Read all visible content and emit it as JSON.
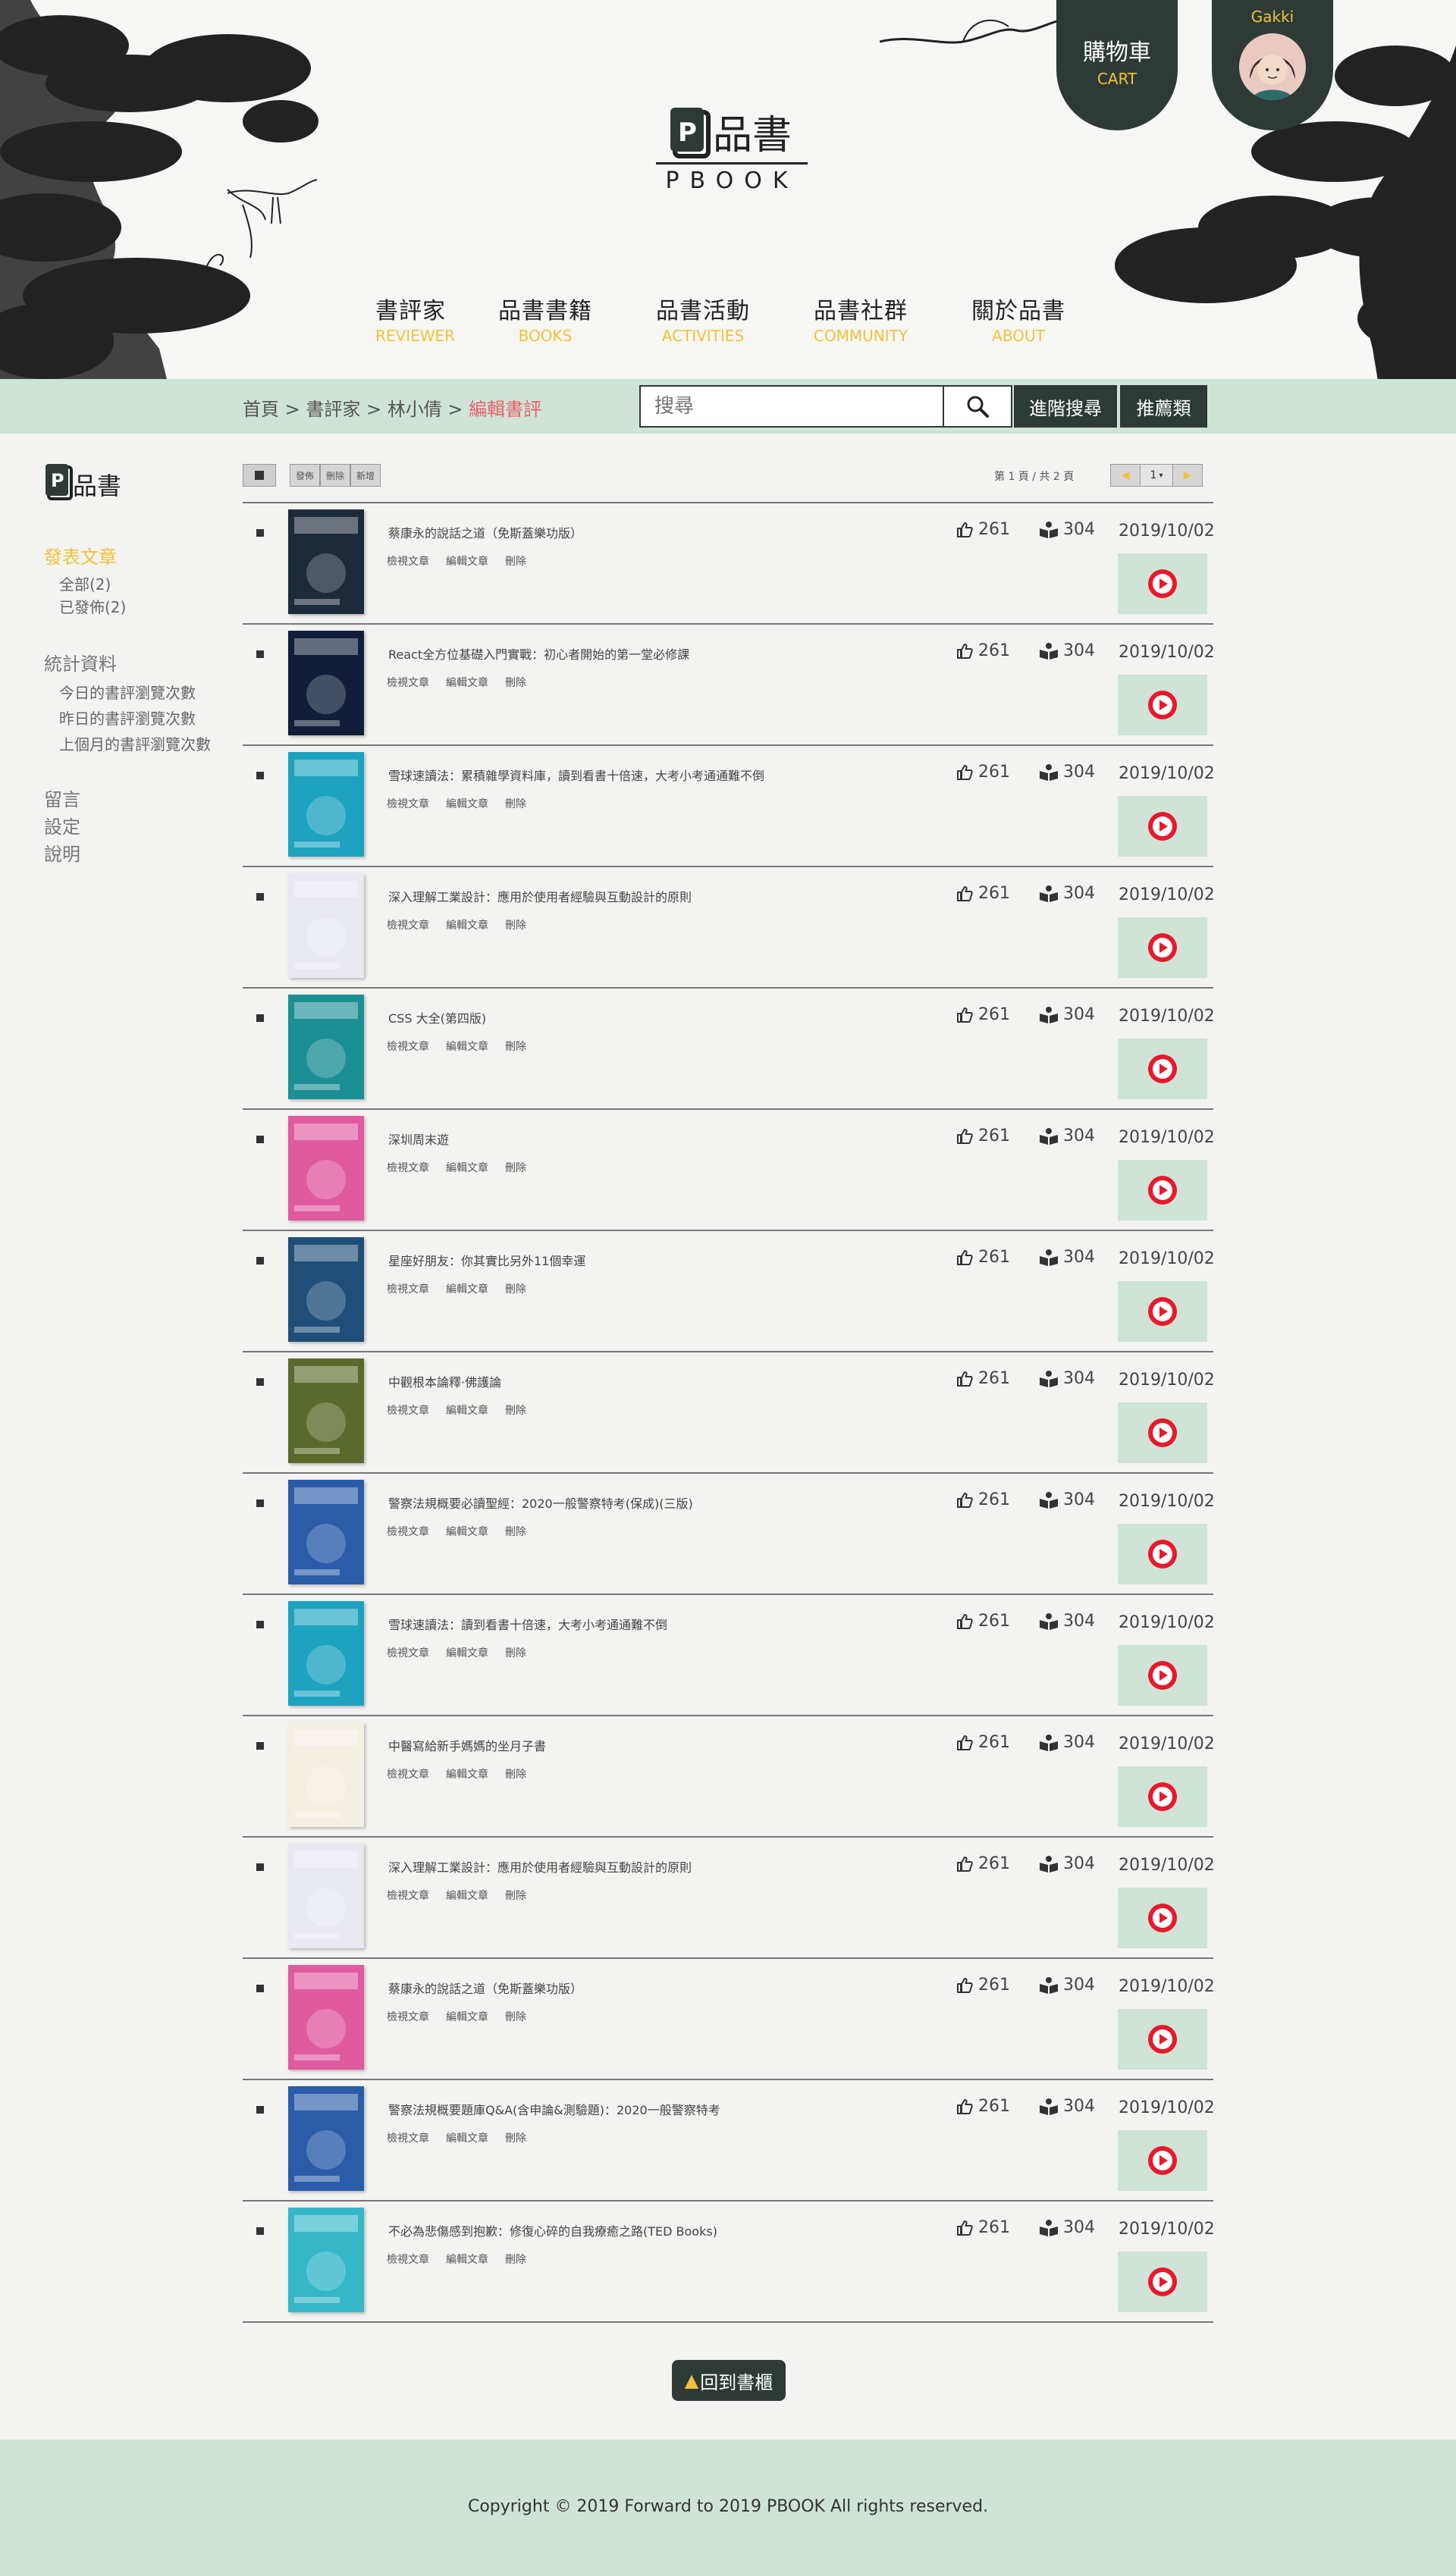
{
  "header": {
    "logo_text": "PBOOK",
    "cart": {
      "zh": "購物車",
      "en": "CART"
    },
    "user": {
      "name": "Gakki"
    }
  },
  "nav": [
    {
      "zh": "書評家",
      "en": "REVIEWER"
    },
    {
      "zh": "品書書籍",
      "en": "BOOKS"
    },
    {
      "zh": "品書活動",
      "en": "ACTIVITIES"
    },
    {
      "zh": "品書社群",
      "en": "COMMUNITY"
    },
    {
      "zh": "關於品書",
      "en": "ABOUT"
    }
  ],
  "breadcrumb": {
    "home": "首頁",
    "reviewer": "書評家",
    "name": "林小倩",
    "current": "編輯書評",
    "sep": ">"
  },
  "search": {
    "placeholder": "搜尋",
    "advanced": "進階搜尋",
    "recommend": "推薦類"
  },
  "sidebar": {
    "posts_heading": "發表文章",
    "posts_items": [
      "全部(2)",
      "已發佈(2)"
    ],
    "stats_heading": "統計資料",
    "stats_items": [
      "今日的書評瀏覽次數",
      "昨日的書評瀏覽次數",
      "上個月的書評瀏覽次數"
    ],
    "links": [
      "留言",
      "設定",
      "說明"
    ]
  },
  "toolbar": {
    "btn_publish": "發佈",
    "btn_delete": "刪除",
    "btn_new": "新增",
    "page_info": "第 1 頁 / 共 2 頁",
    "page_current": "1",
    "prev": "◀",
    "next": "▶"
  },
  "row_actions": {
    "view": "檢視文章",
    "edit": "編輯文章",
    "delete": "刪除"
  },
  "rows": [
    {
      "title": "蔡康永的說話之道（免斯蓋樂功版）",
      "likes": "261",
      "reads": "304",
      "date": "2019/10/02",
      "cover_color": "#1d2a3a"
    },
    {
      "title": "React全方位基礎入門實戰：初心者開始的第一堂必修課",
      "likes": "261",
      "reads": "304",
      "date": "2019/10/02",
      "cover_color": "#101e3a"
    },
    {
      "title": "雪球速讀法：累積雜學資料庫，讀到看書十倍速，大考小考通通難不倒",
      "likes": "261",
      "reads": "304",
      "date": "2019/10/02",
      "cover_color": "#1da3c0"
    },
    {
      "title": "深入理解工業設計：應用於使用者經驗與互動設計的原則",
      "likes": "261",
      "reads": "304",
      "date": "2019/10/02",
      "cover_color": "#e9e9f2"
    },
    {
      "title": "CSS 大全(第四版)",
      "likes": "261",
      "reads": "304",
      "date": "2019/10/02",
      "cover_color": "#1c8f95"
    },
    {
      "title": "深圳周末遊",
      "likes": "261",
      "reads": "304",
      "date": "2019/10/02",
      "cover_color": "#e05aa0"
    },
    {
      "title": "星座好朋友：你其實比另外11個幸運",
      "likes": "261",
      "reads": "304",
      "date": "2019/10/02",
      "cover_color": "#1f4f78"
    },
    {
      "title": "中觀根本論釋·佛護論",
      "likes": "261",
      "reads": "304",
      "date": "2019/10/02",
      "cover_color": "#5a6a2c"
    },
    {
      "title": "警察法規概要必讀聖經：2020一般警察特考(保成)(三版)",
      "likes": "261",
      "reads": "304",
      "date": "2019/10/02",
      "cover_color": "#2a5ca8"
    },
    {
      "title": "雪球速讀法：讀到看書十倍速，大考小考通通難不倒",
      "likes": "261",
      "reads": "304",
      "date": "2019/10/02",
      "cover_color": "#1da3c0"
    },
    {
      "title": "中醫寫給新手媽媽的坐月子書",
      "likes": "261",
      "reads": "304",
      "date": "2019/10/02",
      "cover_color": "#f4efe3"
    },
    {
      "title": "深入理解工業設計：應用於使用者經驗與互動設計的原則",
      "likes": "261",
      "reads": "304",
      "date": "2019/10/02",
      "cover_color": "#e9e9f2"
    },
    {
      "title": "蔡康永的說話之道（免斯蓋樂功版）",
      "likes": "261",
      "reads": "304",
      "date": "2019/10/02",
      "cover_color": "#e05aa0"
    },
    {
      "title": "警察法規概要題庫Q&A(含申論&測驗題)：2020一般警察特考",
      "likes": "261",
      "reads": "304",
      "date": "2019/10/02",
      "cover_color": "#2a5ca8"
    },
    {
      "title": "不必為悲傷感到抱歉：修復心碎的自我療癒之路(TED Books)",
      "likes": "261",
      "reads": "304",
      "date": "2019/10/02",
      "cover_color": "#35b7c8"
    }
  ],
  "back_button": "回到書櫃",
  "footer": {
    "copyright": "Copyright © 2019 Forward to 2019 PBOOK All rights reserved."
  },
  "colors": {
    "accent": "#f2c237",
    "dark": "#2d3a36",
    "mint": "#cfe3d6",
    "highlight": "#e8636b"
  }
}
